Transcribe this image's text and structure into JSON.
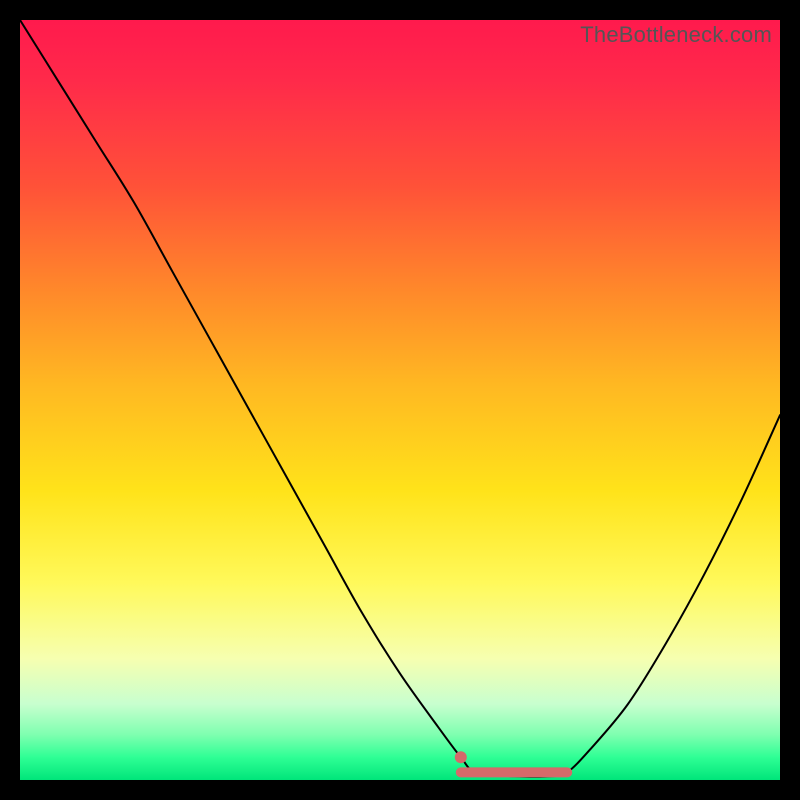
{
  "watermark": "TheBottleneck.com",
  "colors": {
    "curve": "#000000",
    "highlight": "#d46a6a",
    "gradient_top": "#ff1a4d",
    "gradient_bottom": "#00e57a"
  },
  "chart_data": {
    "type": "line",
    "title": "",
    "xlabel": "",
    "ylabel": "",
    "xlim": [
      0,
      100
    ],
    "ylim": [
      0,
      100
    ],
    "x": [
      0,
      5,
      10,
      15,
      20,
      25,
      30,
      35,
      40,
      45,
      50,
      55,
      58,
      60,
      65,
      70,
      72,
      75,
      80,
      85,
      90,
      95,
      100
    ],
    "y": [
      100,
      92,
      84,
      76,
      67,
      58,
      49,
      40,
      31,
      22,
      14,
      7,
      3,
      1,
      0.5,
      0.5,
      1,
      4,
      10,
      18,
      27,
      37,
      48
    ],
    "flat_region": {
      "x_start": 58,
      "x_end": 72,
      "y": 1
    },
    "marker": {
      "x": 58,
      "y": 3
    }
  }
}
